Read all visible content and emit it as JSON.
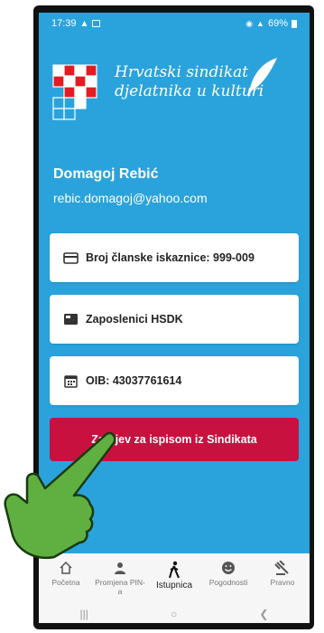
{
  "status": {
    "time": "17:39",
    "battery": "69%"
  },
  "brand": {
    "line1": "Hrvatski sindikat",
    "line2": "djelatnika u kulturi"
  },
  "user": {
    "name": "Domagoj Rebić",
    "email": "rebic.domagoj@yahoo.com"
  },
  "cards": [
    {
      "icon": "card-icon",
      "text": "Broj članske iskaznice: 999-009"
    },
    {
      "icon": "folder-icon",
      "text": "Zaposlenici HSDK"
    },
    {
      "icon": "calendar-icon",
      "text": "OIB: 43037761614"
    }
  ],
  "action": {
    "label": "Zahtjev za ispisom iz Sindikata",
    "color": "#c8113f"
  },
  "nav": [
    {
      "icon": "home-icon",
      "label": "Početna"
    },
    {
      "icon": "person-icon",
      "label": "Promjena PIN-a"
    },
    {
      "icon": "walking-icon",
      "label": "Istupnica",
      "active": true
    },
    {
      "icon": "smile-icon",
      "label": "Pogodnosti"
    },
    {
      "icon": "gavel-icon",
      "label": "Pravno"
    }
  ],
  "colors": {
    "background": "#2aa3dc",
    "accent": "#c8113f"
  }
}
